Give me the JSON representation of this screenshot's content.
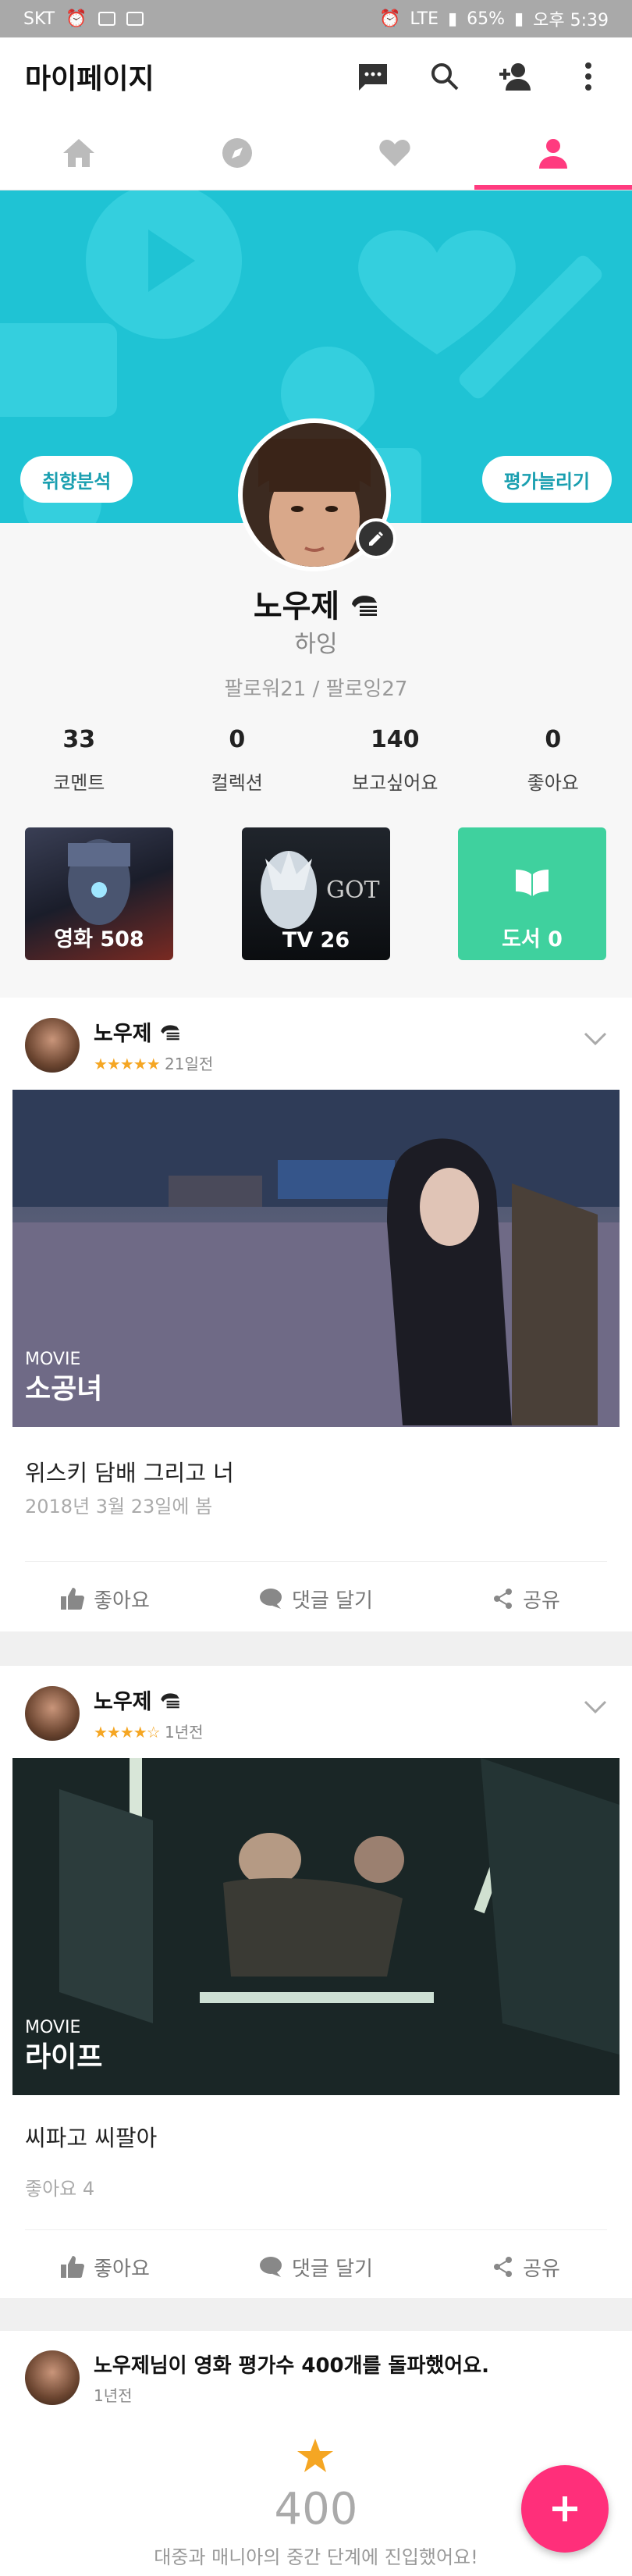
{
  "status_bar": {
    "carrier": "SKT",
    "battery": "65%",
    "time": "오후 5:39",
    "network": "LTE"
  },
  "app_bar": {
    "title": "마이페이지"
  },
  "banner": {
    "left_pill": "취향분석",
    "right_pill": "평가늘리기"
  },
  "profile": {
    "name": "노우제",
    "bio": "하잉",
    "follow": "팔로워21 / 팔로잉27",
    "stats": [
      {
        "num": "33",
        "label": "코멘트"
      },
      {
        "num": "0",
        "label": "컬렉션"
      },
      {
        "num": "140",
        "label": "보고싶어요"
      },
      {
        "num": "0",
        "label": "좋아요"
      }
    ]
  },
  "tiles": {
    "movie": "영화 508",
    "tv": "TV 26",
    "book": "도서 0",
    "tv_logo_text": "GOT"
  },
  "cards": [
    {
      "name": "노우제",
      "stars": "★★★★★",
      "time": "21일전",
      "kind": "MOVIE",
      "title": "소공녀",
      "comment": "위스키 담배 그리고 너",
      "sub": "2018년 3월 23일에 봄",
      "actions": [
        "좋아요",
        "댓글 달기",
        "공유"
      ]
    },
    {
      "name": "노우제",
      "stars": "★★★★☆",
      "time": "1년전",
      "kind": "MOVIE",
      "title": "라이프",
      "comment": "씨파고 씨팔아",
      "sub": "좋아요 4",
      "actions": [
        "좋아요",
        "댓글 달기",
        "공유"
      ]
    }
  ],
  "milestone": {
    "text": "노우제님이 영화 평가수 400개를 돌파했어요.",
    "time": "1년전",
    "count": "400",
    "caption": "대중과 매니아의 중간 단계에 진입했어요!"
  },
  "colors": {
    "accent": "#ff3b7f",
    "banner": "#1fc3d4",
    "book": "#3fd19e",
    "star": "#f5a623"
  }
}
